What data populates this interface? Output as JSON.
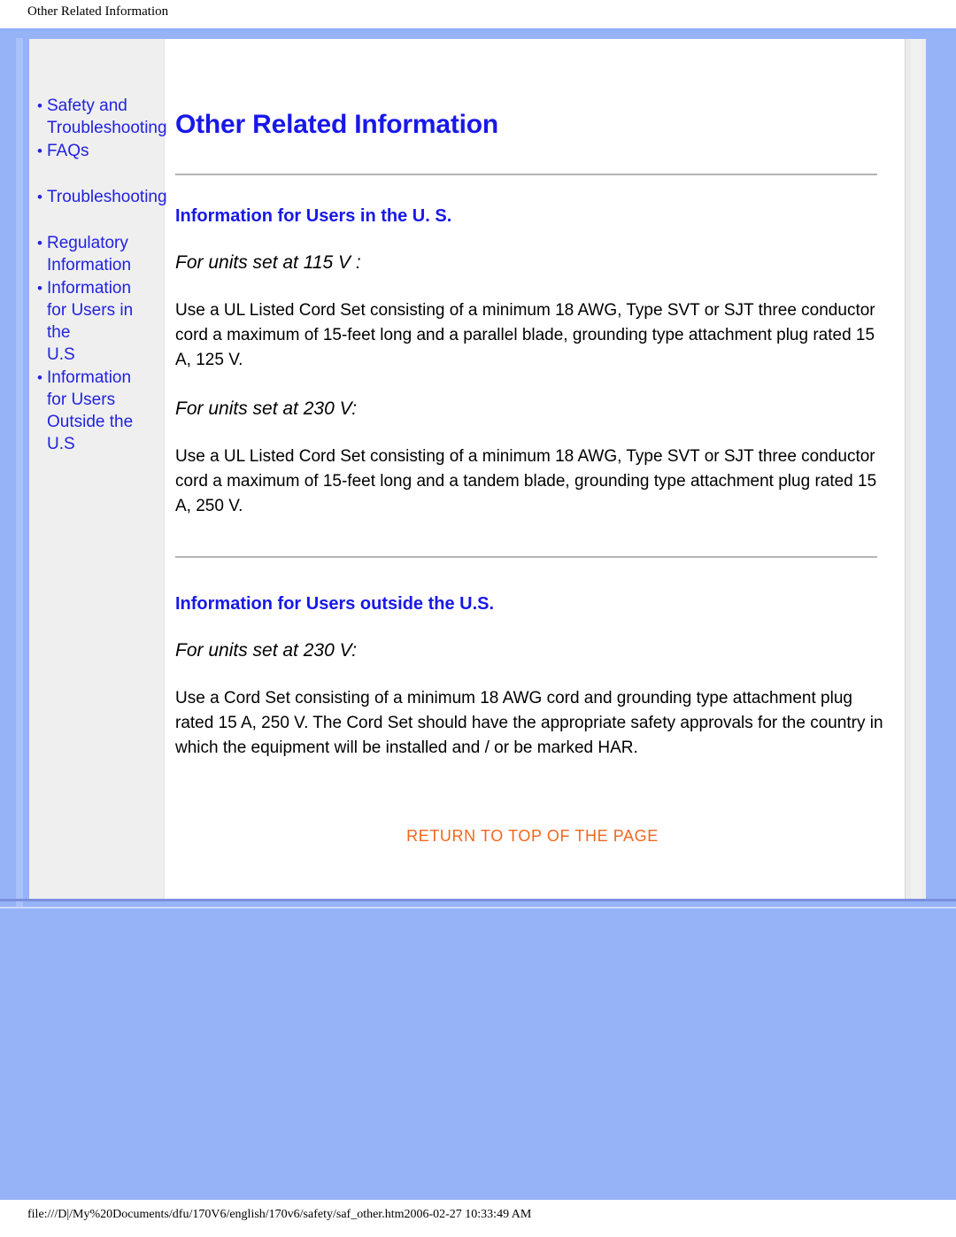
{
  "print": {
    "running_head": "Other Related Information",
    "footer_path": "file:///D|/My%20Documents/dfu/170V6/english/170v6/safety/saf_other.htm2006-02-27 10:33:49 AM"
  },
  "colors": {
    "frame_blue": "#96b3f8",
    "link_blue": "#2222e0",
    "heading_blue": "#1818e8",
    "return_orange": "#f4661e",
    "sidebar_gray": "#efefef"
  },
  "sidebar": {
    "groups": [
      {
        "items": [
          {
            "label": "Safety and\nTroubleshooting"
          },
          {
            "label": "FAQs"
          }
        ]
      },
      {
        "items": [
          {
            "label": "Troubleshooting"
          }
        ]
      },
      {
        "items": [
          {
            "label": "Regulatory\nInformation"
          },
          {
            "label": "Information\nfor Users in the\nU.S"
          },
          {
            "label": "Information\nfor Users\nOutside the U.S"
          }
        ]
      }
    ],
    "bullet": "•"
  },
  "main": {
    "title": "Other Related Information",
    "sections": [
      {
        "heading": "Information for Users in the U. S.",
        "blocks": [
          {
            "subhead": "For units set at 115 V :",
            "body": "Use a UL Listed Cord Set consisting of a minimum 18 AWG, Type SVT or SJT three conductor cord a maximum of 15-feet long and a parallel blade, grounding type attachment plug rated 15 A, 125 V."
          },
          {
            "subhead": "For units set at 230 V:",
            "body": "Use a UL Listed Cord Set consisting of a minimum 18 AWG, Type SVT or SJT three conductor cord a maximum of 15-feet long and a tandem blade, grounding type attachment plug rated 15 A, 250 V."
          }
        ]
      },
      {
        "heading": "Information for Users outside the U.S.",
        "blocks": [
          {
            "subhead": "For units set at 230 V:",
            "body": "Use a Cord Set consisting of a minimum 18 AWG cord and grounding type attachment plug rated 15 A, 250 V. The Cord Set should have the appropriate safety approvals for the country in which the equipment will be installed and / or be marked HAR."
          }
        ]
      }
    ],
    "return_to_top": "RETURN TO TOP OF THE PAGE"
  }
}
